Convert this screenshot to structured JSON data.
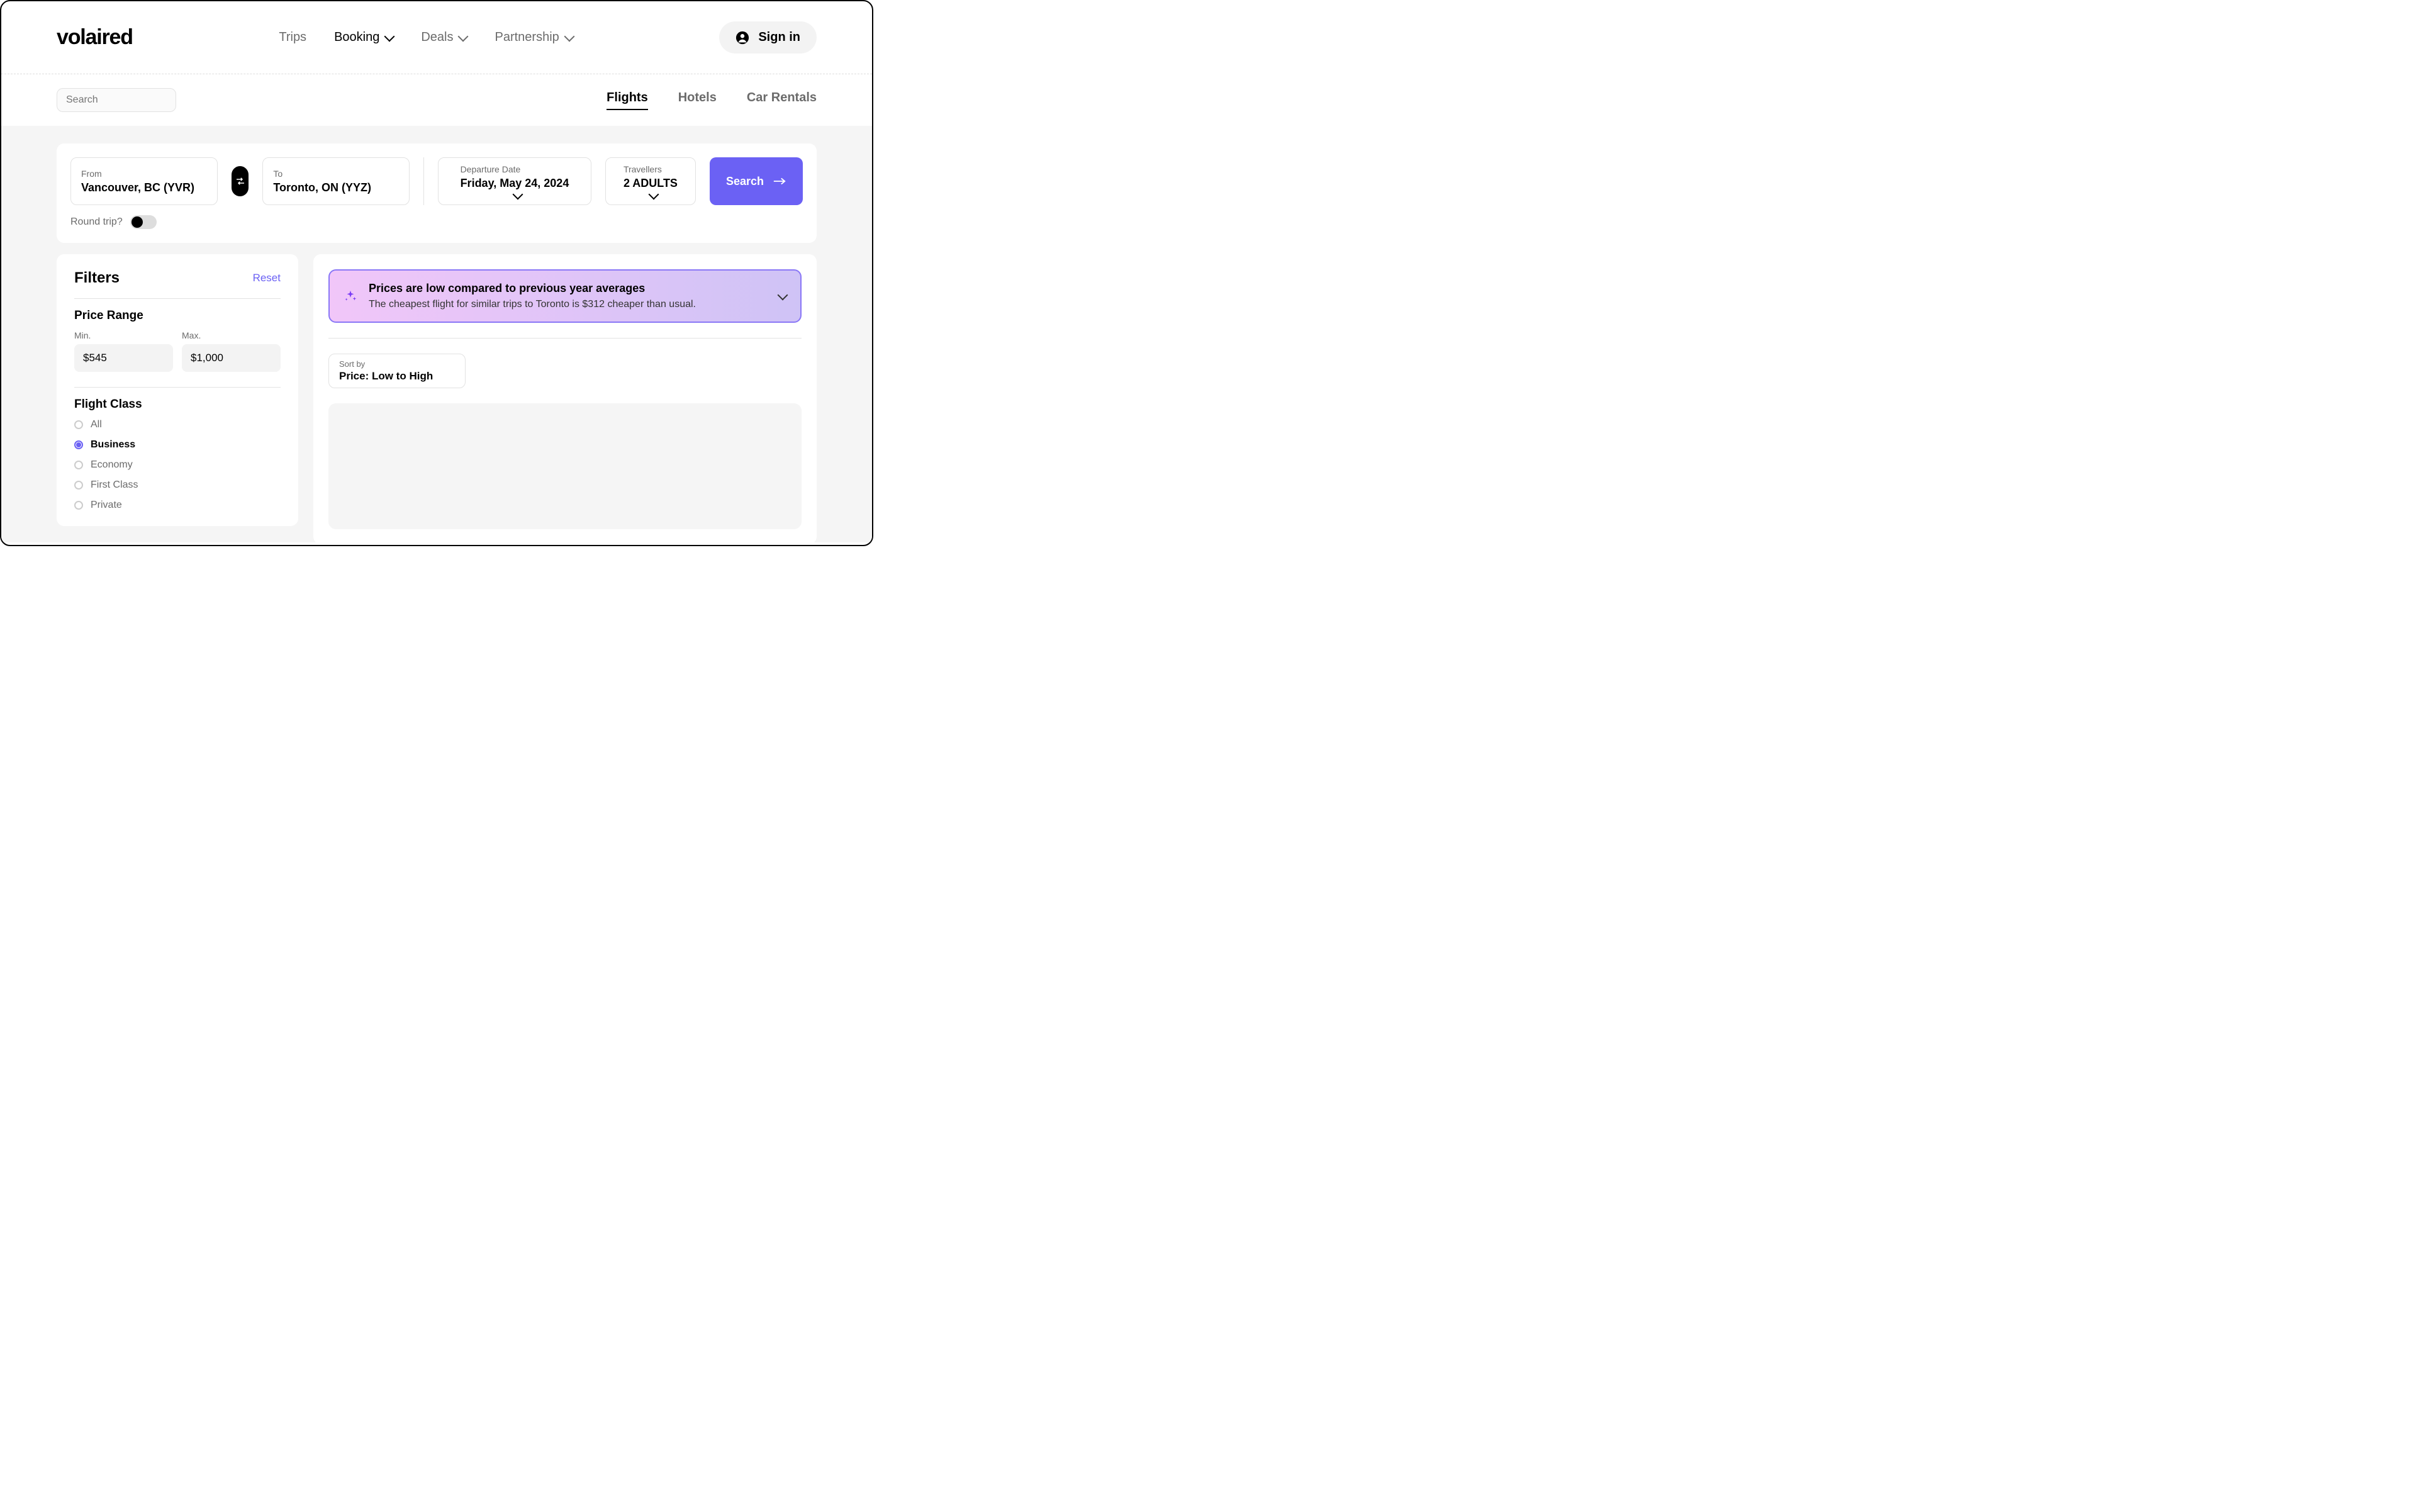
{
  "brand": "volaired",
  "nav": {
    "trips": "Trips",
    "booking": "Booking",
    "deals": "Deals",
    "partnership": "Partnership",
    "sign_in": "Sign in"
  },
  "search": {
    "placeholder": "Search"
  },
  "tabs": {
    "flights": "Flights",
    "hotels": "Hotels",
    "car_rentals": "Car Rentals"
  },
  "form": {
    "from_label": "From",
    "from_value": "Vancouver, BC (YVR)",
    "to_label": "To",
    "to_value": "Toronto, ON (YYZ)",
    "departure_label": "Departure Date",
    "departure_value": "Friday, May 24, 2024",
    "travellers_label": "Travellers",
    "travellers_value": "2 ADULTS",
    "search_btn": "Search",
    "round_trip_label": "Round trip?"
  },
  "filters": {
    "title": "Filters",
    "reset": "Reset",
    "price_range_title": "Price Range",
    "min_label": "Min.",
    "max_label": "Max.",
    "min_value": "$545",
    "max_value": "$1,000",
    "class_title": "Flight Class",
    "classes": [
      "All",
      "Business",
      "Economy",
      "First Class",
      "Private"
    ],
    "selected_class_index": 1
  },
  "banner": {
    "title": "Prices are low compared to previous year averages",
    "sub": "The cheapest flight for similar trips to Toronto is $312 cheaper than usual."
  },
  "sort": {
    "label": "Sort by",
    "value": "Price: Low to High"
  }
}
